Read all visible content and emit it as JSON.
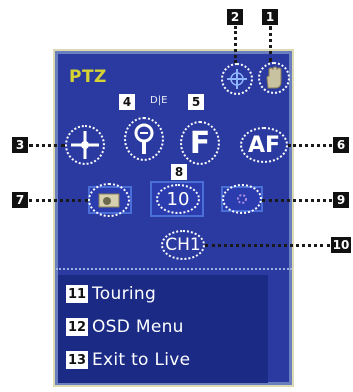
{
  "panel": {
    "title": "PTZ",
    "title_color": "#d6d233",
    "background": "#2b3aa0",
    "border_color": "#dcdab4"
  },
  "buttons": {
    "aux": {
      "icon": "crosshair-icon"
    },
    "hold": {
      "icon": "hand-icon"
    },
    "pan_tilt": {
      "icon": "move-arrows-icon"
    },
    "zoom": {
      "icon": "zoom-icon"
    },
    "focus": {
      "label": "F"
    },
    "autofocus": {
      "label": "AF"
    },
    "preset_prev": {
      "icon": "camera-icon"
    },
    "preset_value": {
      "label": "10"
    },
    "preset_next": {
      "icon": "dotted-circle-icon"
    },
    "channel": {
      "label": "CH1"
    }
  },
  "callouts": [
    "1",
    "2",
    "3",
    "4",
    "5",
    "6",
    "7",
    "8",
    "9",
    "10"
  ],
  "menu": {
    "items": [
      {
        "num": "11",
        "label": "Touring"
      },
      {
        "num": "12",
        "label": "OSD Menu"
      },
      {
        "num": "13",
        "label": "Exit to Live"
      }
    ]
  }
}
